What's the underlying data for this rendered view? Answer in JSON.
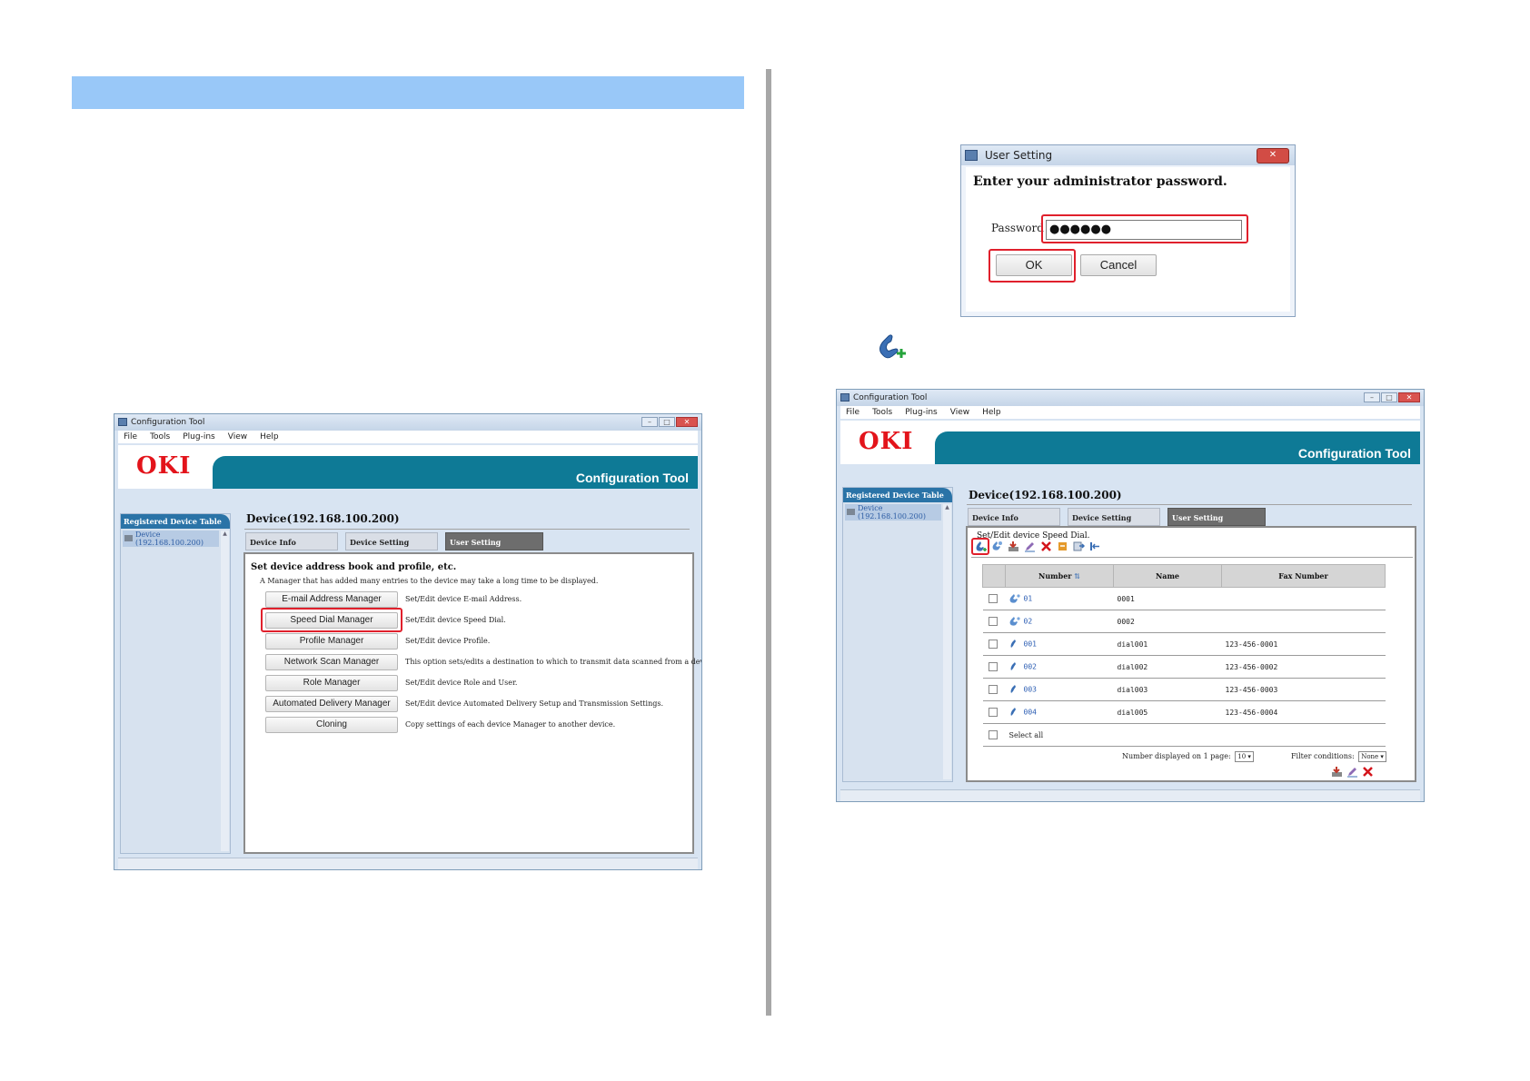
{
  "page": {},
  "window": {
    "title": "Configuration Tool",
    "menu": [
      "File",
      "Tools",
      "Plug-ins",
      "View",
      "Help"
    ],
    "logo": "OKI",
    "banner_title": "Configuration Tool",
    "sidebar_header": "Registered Device Table",
    "sidebar_device": [
      "Device",
      "(192.168.100.200)"
    ],
    "device_title": "Device(192.168.100.200)",
    "tabs": [
      "Device Info",
      "Device Setting",
      "User Setting"
    ],
    "minimize": "–",
    "maximize": "□",
    "close": "✕"
  },
  "left_panel": {
    "heading": "Set device address book and profile, etc.",
    "note": "A Manager that has added many entries to the device may take a long time to be displayed.",
    "managers": [
      {
        "label": "E-mail Address Manager",
        "desc": "Set/Edit device E-mail Address."
      },
      {
        "label": "Speed Dial Manager",
        "desc": "Set/Edit device Speed Dial."
      },
      {
        "label": "Profile Manager",
        "desc": "Set/Edit device Profile."
      },
      {
        "label": "Network Scan Manager",
        "desc": "This option sets/edits a destination to which to transmit data scanned from a device."
      },
      {
        "label": "Role Manager",
        "desc": "Set/Edit device Role  and User."
      },
      {
        "label": "Automated Delivery Manager",
        "desc": "Set/Edit device Automated Delivery Setup and Transmission Settings."
      },
      {
        "label": "Cloning",
        "desc": "Copy settings of each device Manager to another device."
      }
    ]
  },
  "dialog": {
    "title": "User Setting",
    "prompt": "Enter your administrator password.",
    "password_label": "Password",
    "password_value": "●●●●●●",
    "ok": "OK",
    "cancel": "Cancel",
    "close": "✕"
  },
  "speed_dial": {
    "label": "Set/Edit device Speed Dial.",
    "columns": [
      "Number",
      "Name",
      "Fax Number"
    ],
    "rows": [
      {
        "icon": "group-phone-icon",
        "number": "01",
        "name": "0001",
        "fax": ""
      },
      {
        "icon": "group-phone-icon",
        "number": "02",
        "name": "0002",
        "fax": ""
      },
      {
        "icon": "phone-icon",
        "number": "001",
        "name": "dial001",
        "fax": "123-456-0001"
      },
      {
        "icon": "phone-icon",
        "number": "002",
        "name": "dial002",
        "fax": "123-456-0002"
      },
      {
        "icon": "phone-icon",
        "number": "003",
        "name": "dial003",
        "fax": "123-456-0003"
      },
      {
        "icon": "phone-icon",
        "number": "004",
        "name": "dial005",
        "fax": "123-456-0004"
      }
    ],
    "select_all": "Select all",
    "per_page_label": "Number displayed on 1 page:",
    "per_page_value": "10",
    "filter_label": "Filter conditions:",
    "filter_value": "None",
    "sort_icon": "⇅"
  },
  "colors": {
    "header_bar": "#99c8f8",
    "banner": "#0e7a96",
    "logo": "#e3141b",
    "highlight": "#e0202c"
  }
}
